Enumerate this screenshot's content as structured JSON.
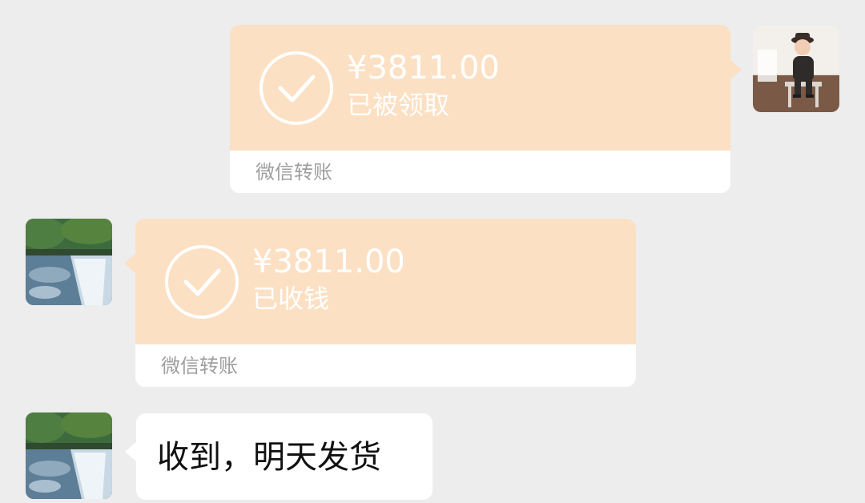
{
  "messages": [
    {
      "side": "right",
      "kind": "transfer",
      "amount": "¥3811.00",
      "status": "已被领取",
      "caption": "微信转账",
      "icon": "check-circle-icon"
    },
    {
      "side": "left",
      "kind": "transfer",
      "amount": "¥3811.00",
      "status": "已收钱",
      "caption": "微信转账",
      "icon": "check-circle-icon"
    },
    {
      "side": "left",
      "kind": "text",
      "text": "收到，明天发货"
    }
  ],
  "colors": {
    "background": "#ededed",
    "transfer_bubble": "#fce0c3",
    "transfer_footer": "#ffffff",
    "caption_text": "#9e9e9e",
    "message_text": "#111111"
  }
}
